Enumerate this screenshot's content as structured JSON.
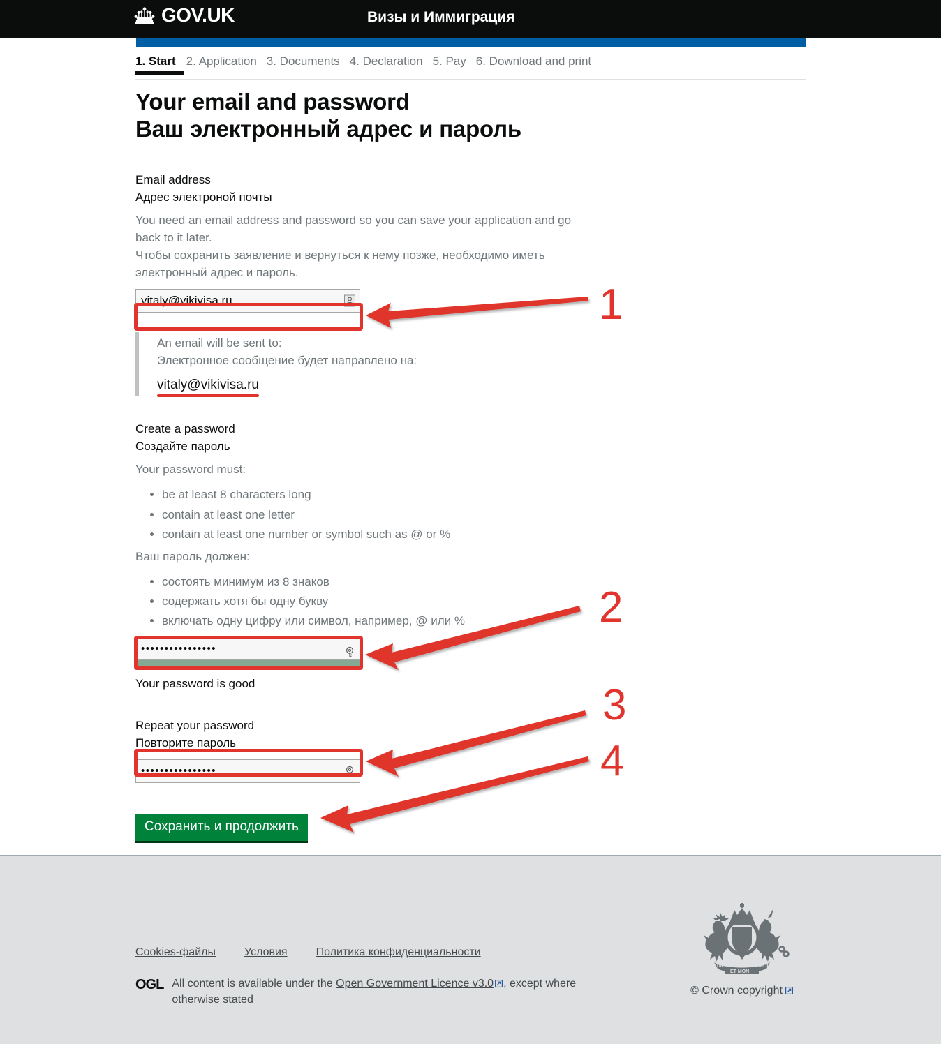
{
  "header": {
    "brand": "GOV.UK",
    "crown_icon": "crown-icon",
    "service_name": "Визы и Иммиграция"
  },
  "phase_nav": {
    "items": [
      {
        "label": "1. Start",
        "active": true
      },
      {
        "label": "2. Application",
        "active": false
      },
      {
        "label": "3. Documents",
        "active": false
      },
      {
        "label": "4. Declaration",
        "active": false
      },
      {
        "label": "5. Pay",
        "active": false
      },
      {
        "label": "6. Download and print",
        "active": false
      }
    ]
  },
  "page": {
    "title_en": "Your email and password",
    "title_ru": "Ваш электронный адрес и пароль"
  },
  "email_section": {
    "label_en": "Email address",
    "label_ru": "Адрес электроной почты",
    "hint_en": "You need an email address and password so you can save your application and go back to it later.",
    "hint_ru": "Чтобы сохранить заявление и вернуться к нему позже, необходимо иметь электронный адрес и пароль.",
    "input_value": "vitaly@vikivisa.ru",
    "input_placeholder": "",
    "input_icon": "contact-card-icon",
    "inset_line_en": "An email will be sent to:",
    "inset_line_ru": "Электронное сообщение будет направлено на:",
    "inset_email": "vitaly@vikivisa.ru"
  },
  "password_section": {
    "label_en": "Create a password",
    "label_ru": "Создайте пароль",
    "must_en": "Your password must:",
    "reqs_en": [
      "be at least 8 characters long",
      "contain at least one letter",
      "contain at least one number or symbol such as @ or %"
    ],
    "must_ru": "Ваш пароль должен:",
    "reqs_ru": [
      "состоять минимум из 8 знаков",
      "содержать хотя бы одну букву",
      "включать одну цифру или символ, например, @ или %"
    ],
    "input_value": "••••••••••••••••",
    "input_icon": "key-icon",
    "strength_color": "#85a893",
    "status": "Your password is good"
  },
  "repeat_section": {
    "label_en": "Repeat your password",
    "label_ru": "Повторите пароль",
    "input_value": "••••••••••••••••",
    "input_icon": "key-icon"
  },
  "submit": {
    "label": "Сохранить и продолжить"
  },
  "annotations": {
    "color": "#e0342c",
    "markers": [
      "1",
      "2",
      "3",
      "4"
    ]
  },
  "footer": {
    "links": [
      "Cookies-файлы",
      "Условия",
      "Политика конфиденциальности"
    ],
    "ogl_badge": "OGL",
    "ogl_text_before": "All content is available under the ",
    "ogl_link": "Open Government Licence v3.0",
    "ogl_text_after": ", except where otherwise stated",
    "crest_icon": "royal-coat-of-arms-icon",
    "copyright": "© Crown copyright"
  },
  "colors": {
    "header_bg": "#0b0c0c",
    "blue_bar": "#005ea5",
    "annotation_red": "#e0342c",
    "button_green": "#00823b",
    "footer_bg": "#dee0e2"
  }
}
